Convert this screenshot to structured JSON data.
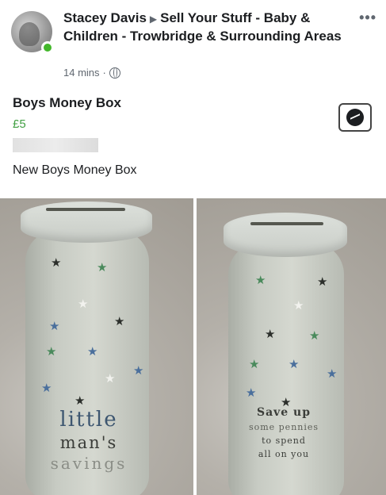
{
  "post": {
    "poster_name": "Stacey Davis",
    "arrow": "▶",
    "group_name": "Sell Your Stuff - Baby & Children - Trowbridge & Surrounding Areas",
    "time": "14 mins",
    "separator": "·",
    "more": "•••"
  },
  "listing": {
    "title": "Boys Money Box",
    "price": "£5",
    "description": "New Boys Money Box"
  },
  "photo_left": {
    "text_line1": "little",
    "text_line2": "man's",
    "text_line3": "savings"
  },
  "photo_right": {
    "text_line1": "Save up",
    "text_line2": "some pennies",
    "text_line3": "to spend",
    "text_line4": "all on you"
  },
  "colors": {
    "price": "#42a044",
    "online": "#42b72a",
    "star_dark": "#2c2f2b",
    "star_blue": "#4a6f9c",
    "star_green": "#4a8a5c",
    "star_white": "#f2f2ee"
  },
  "icons": [
    "online-dot-icon",
    "globe-icon",
    "more-icon",
    "messenger-icon",
    "star-icon"
  ]
}
